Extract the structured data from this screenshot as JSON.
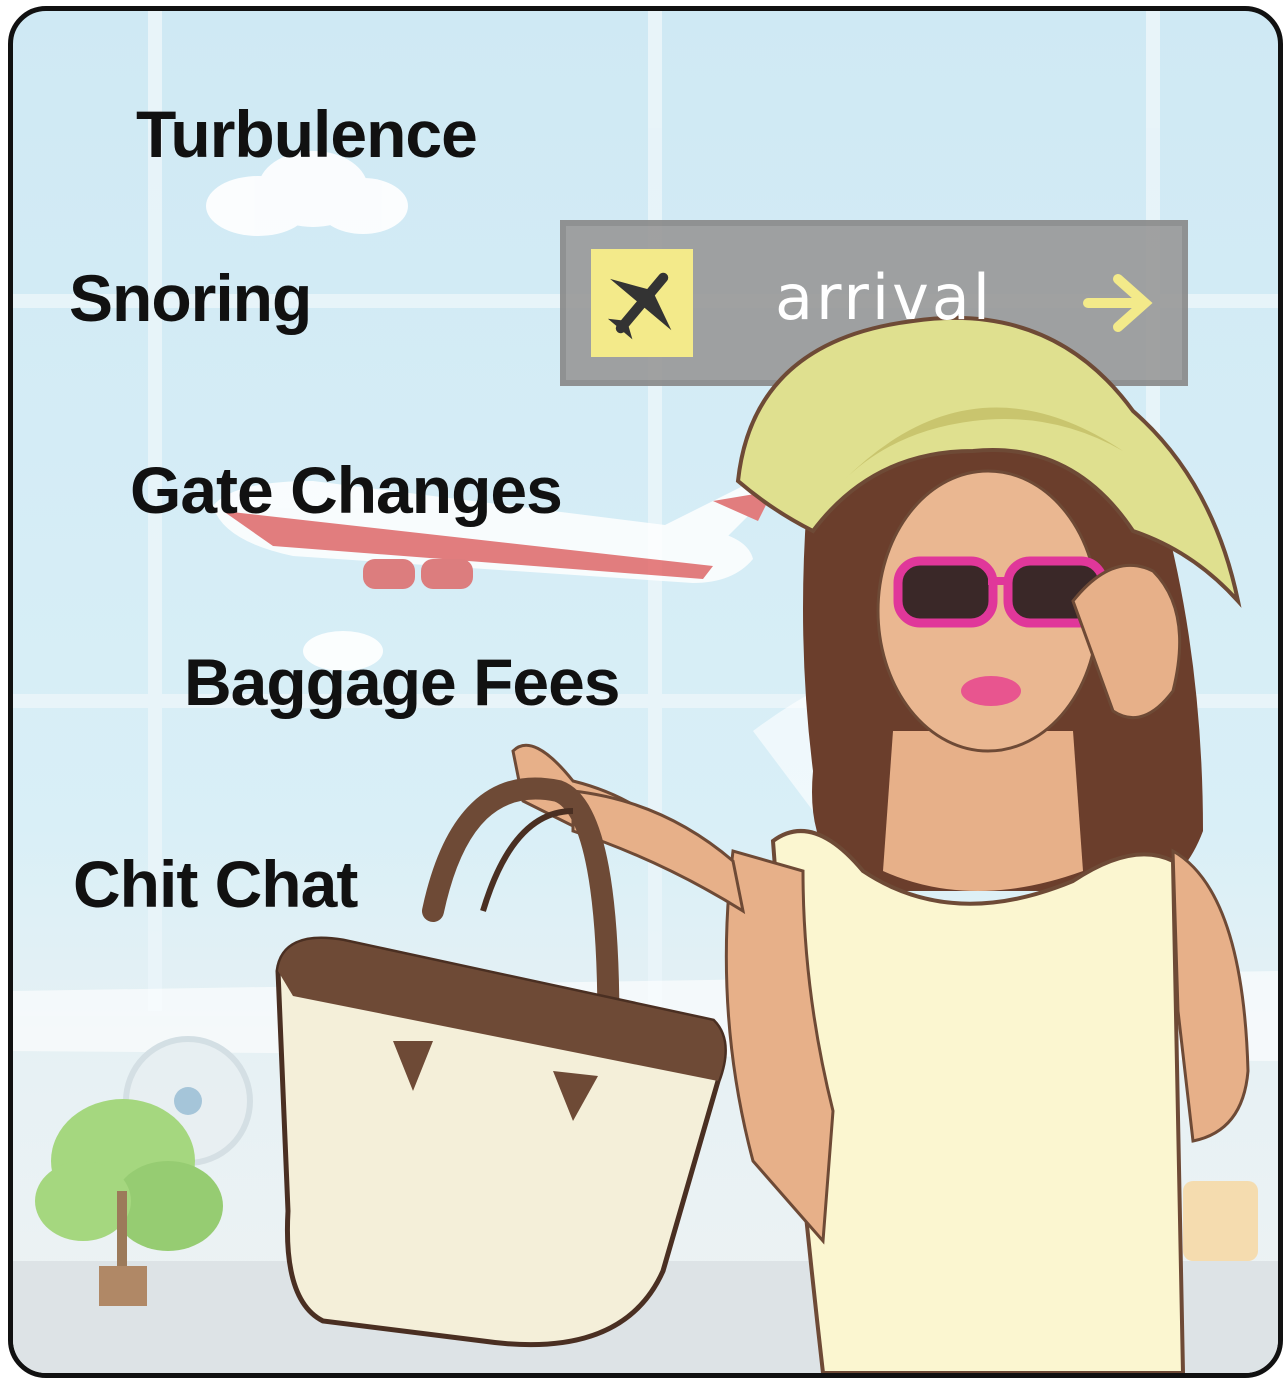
{
  "captions": [
    {
      "id": "turbulence",
      "text": "Turbulence"
    },
    {
      "id": "snoring",
      "text": "Snoring"
    },
    {
      "id": "gate-changes",
      "text": "Gate Changes"
    },
    {
      "id": "baggage-fees",
      "text": "Baggage Fees"
    },
    {
      "id": "chit-chat",
      "text": "Chit Chat"
    }
  ],
  "sign": {
    "text": "arrival",
    "icon": "airplane-icon",
    "arrow": "arrow-right-icon"
  },
  "colors": {
    "sky": "#d5edf6",
    "sign_bg": "#9e9e9e",
    "sign_icon_bg": "#f3ea8a",
    "hat": "#dfe08f",
    "sunglasses": "#e0379a",
    "bag_trim": "#6e4a36"
  }
}
